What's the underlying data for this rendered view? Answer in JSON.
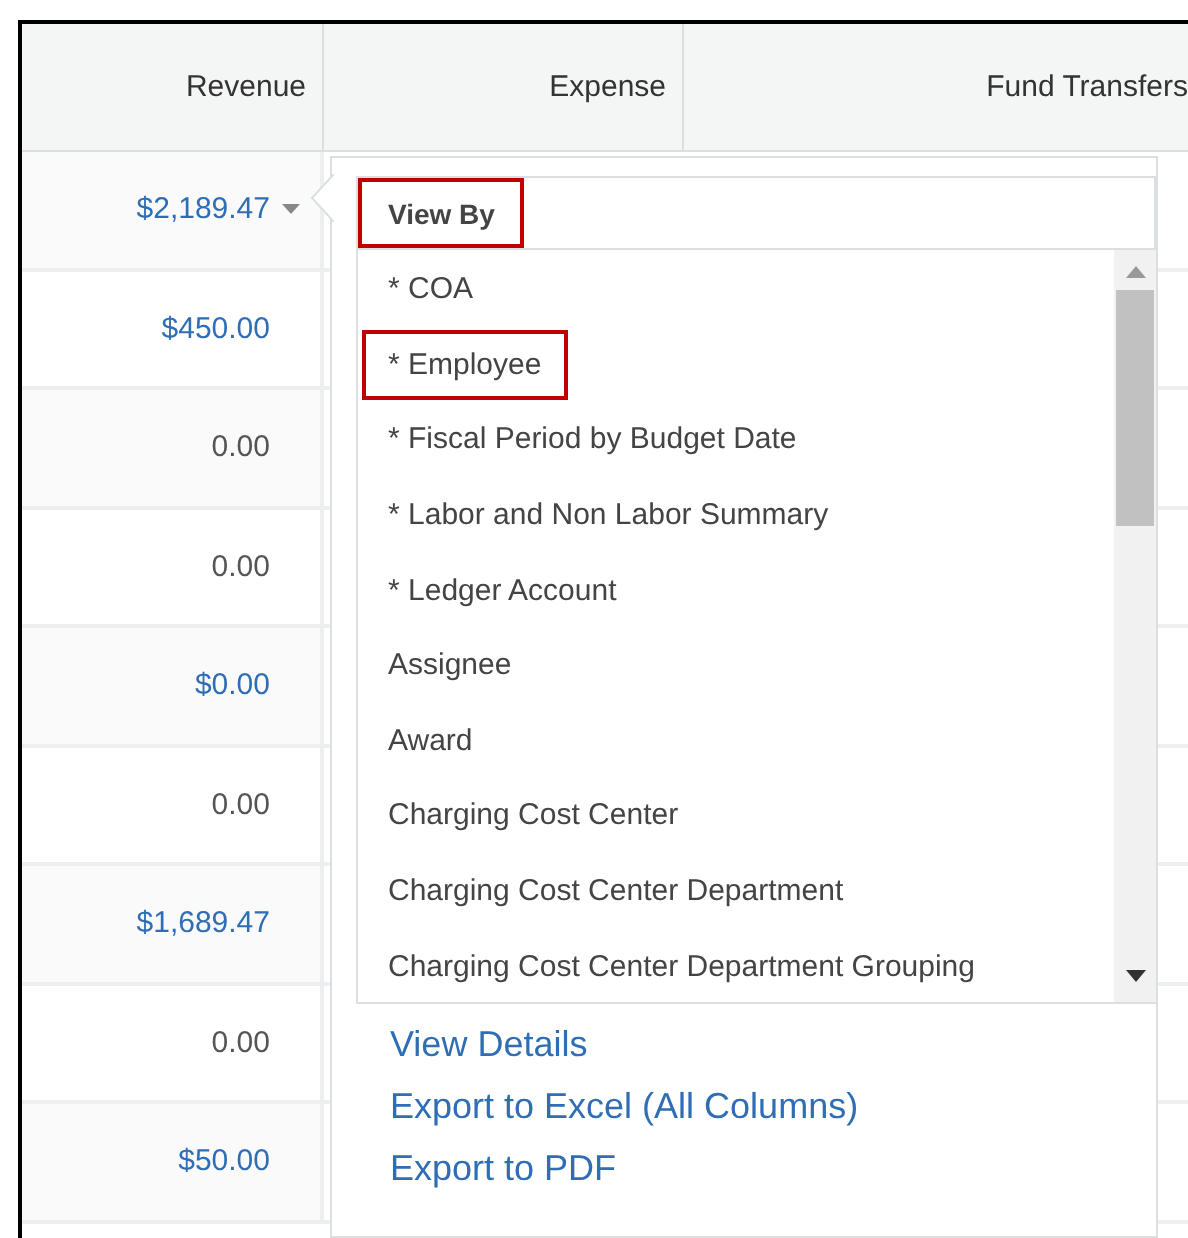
{
  "table": {
    "columns": [
      "Revenue",
      "Expense",
      "Fund Transfers"
    ],
    "rows": [
      {
        "revenue": "$2,189.47",
        "link": true,
        "menu_open": true
      },
      {
        "revenue": "$450.00",
        "link": true,
        "menu_open": false
      },
      {
        "revenue": "0.00",
        "link": false,
        "menu_open": false
      },
      {
        "revenue": "0.00",
        "link": false,
        "menu_open": false
      },
      {
        "revenue": "$0.00",
        "link": true,
        "menu_open": false
      },
      {
        "revenue": "0.00",
        "link": false,
        "menu_open": false
      },
      {
        "revenue": "$1,689.47",
        "link": true,
        "menu_open": false
      },
      {
        "revenue": "0.00",
        "link": false,
        "menu_open": false
      },
      {
        "revenue": "$50.00",
        "link": true,
        "menu_open": false
      }
    ]
  },
  "popup": {
    "view_by": {
      "label": "View By",
      "highlighted": true
    },
    "options": [
      {
        "label": "* COA",
        "highlighted": false
      },
      {
        "label": "* Employee",
        "highlighted": true
      },
      {
        "label": "* Fiscal Period by Budget Date",
        "highlighted": false
      },
      {
        "label": "* Labor and Non Labor Summary",
        "highlighted": false
      },
      {
        "label": "* Ledger Account",
        "highlighted": false
      },
      {
        "label": "Assignee",
        "highlighted": false
      },
      {
        "label": "Award",
        "highlighted": false
      },
      {
        "label": "Charging Cost Center",
        "highlighted": false
      },
      {
        "label": "Charging Cost Center Department",
        "highlighted": false
      },
      {
        "label": "Charging Cost Center Department Grouping",
        "highlighted": false
      }
    ],
    "actions": [
      "View Details",
      "Export to Excel (All Columns)",
      "Export to PDF"
    ]
  }
}
